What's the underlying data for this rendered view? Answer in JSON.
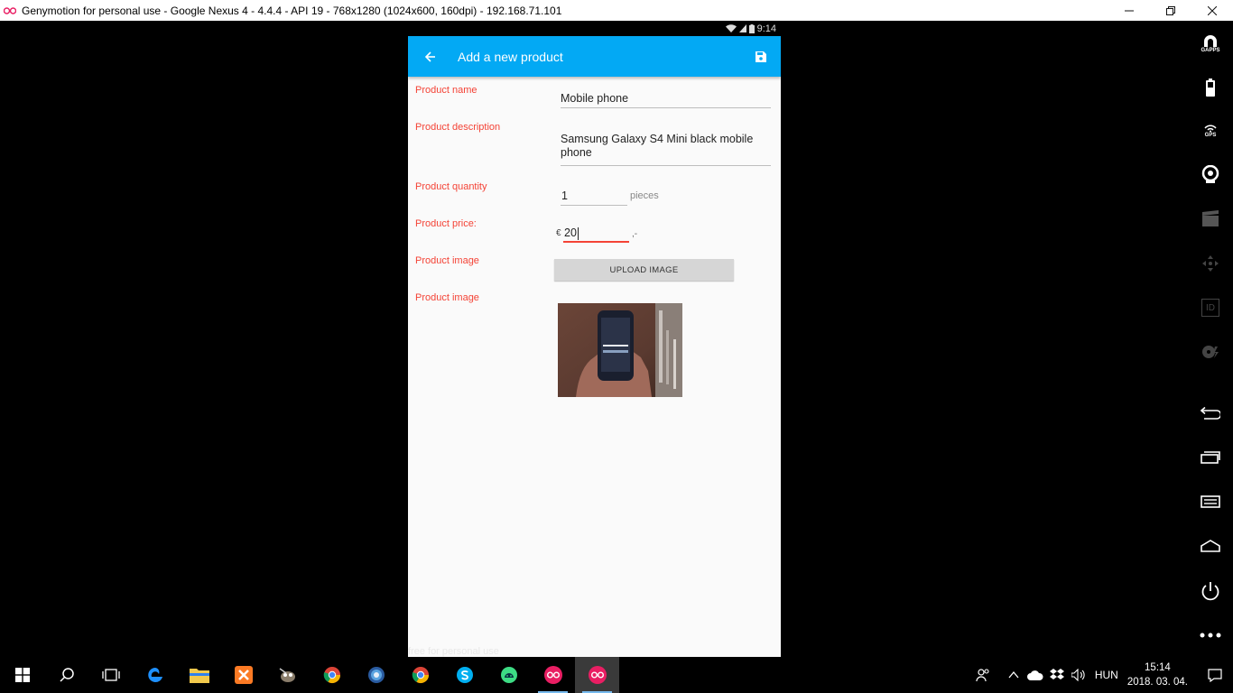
{
  "window": {
    "title": "Genymotion for personal use - Google Nexus 4 - 4.4.4 - API 19 - 768x1280 (1024x600, 160dpi) - 192.168.71.101",
    "controls": [
      "minimize",
      "restore",
      "close"
    ]
  },
  "android": {
    "status_time": "9:14",
    "appbar_title": "Add a new product",
    "form": {
      "name_label": "Product name",
      "name_value": "Mobile phone",
      "description_label": "Product description",
      "description_value": "Samsung Galaxy S4 Mini black mobile phone",
      "quantity_label": "Product quantity",
      "quantity_value": "1",
      "quantity_suffix": "pieces",
      "price_label": "Product price:",
      "price_currency": "€",
      "price_value": "20",
      "price_suffix": ",-",
      "image_label": "Product image",
      "upload_button": "UPLOAD IMAGE",
      "image_preview_label": "Product image"
    },
    "watermark": "free for personal use"
  },
  "side_toolbar": {
    "gapps_label": "GAPPS",
    "gps_label": "GPS",
    "id_label": "ID"
  },
  "taskbar": {
    "language": "HUN",
    "time": "15:14",
    "date": "2018. 03. 04."
  },
  "colors": {
    "appbar": "#03a9f4",
    "label": "#f44336",
    "taskbar": "#000000"
  }
}
